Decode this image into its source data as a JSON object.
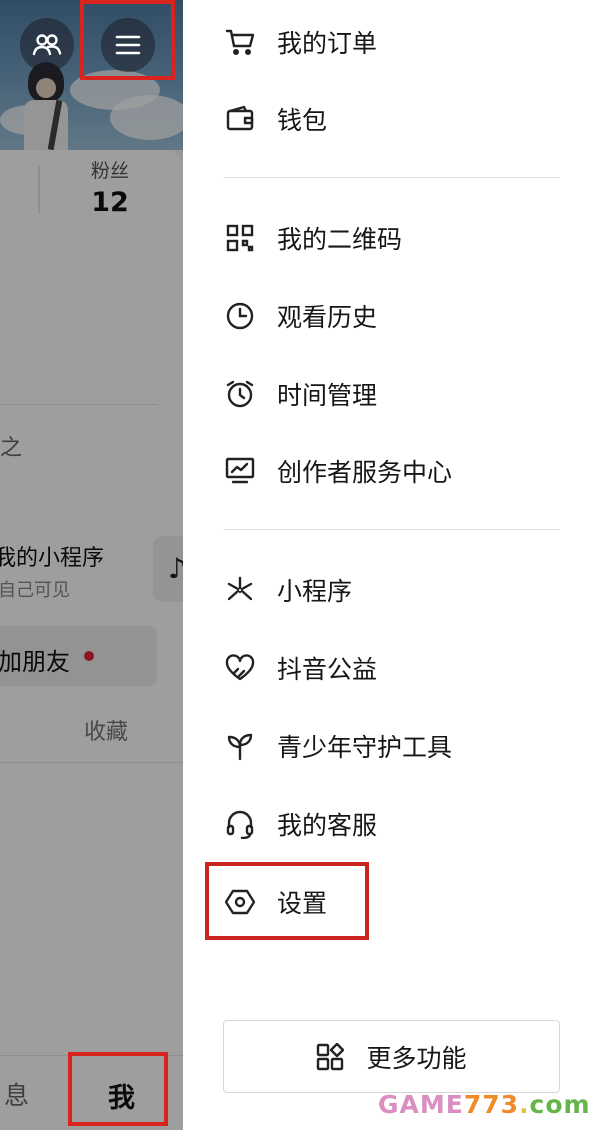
{
  "profile": {
    "fans_label": "粉丝",
    "fans_count": "12",
    "partial_text": "之",
    "mini_program_title": "我的小程序",
    "mini_program_sub": "自己可见",
    "add_friend": "加朋友",
    "favorites_tab": "收藏"
  },
  "bottom_nav": {
    "messages": "息",
    "me": "我"
  },
  "menu": {
    "group1": [
      {
        "label": "我的订单",
        "icon": "cart-icon"
      },
      {
        "label": "钱包",
        "icon": "wallet-icon"
      }
    ],
    "group2": [
      {
        "label": "我的二维码",
        "icon": "qrcode-icon"
      },
      {
        "label": "观看历史",
        "icon": "clock-icon"
      },
      {
        "label": "时间管理",
        "icon": "alarm-icon"
      },
      {
        "label": "创作者服务中心",
        "icon": "chart-icon"
      }
    ],
    "group3": [
      {
        "label": "小程序",
        "icon": "asterisk-icon"
      },
      {
        "label": "抖音公益",
        "icon": "heart-icon"
      },
      {
        "label": "青少年守护工具",
        "icon": "sprout-icon"
      },
      {
        "label": "我的客服",
        "icon": "headset-icon"
      },
      {
        "label": "设置",
        "icon": "hexagon-settings-icon"
      }
    ],
    "more_button": "更多功能"
  },
  "watermark": {
    "part1": "GAME",
    "part2": "773",
    "part3": ".",
    "part4": "com"
  },
  "colors": {
    "highlight_red": "#d8231f",
    "notification_dot": "#e2243c"
  }
}
